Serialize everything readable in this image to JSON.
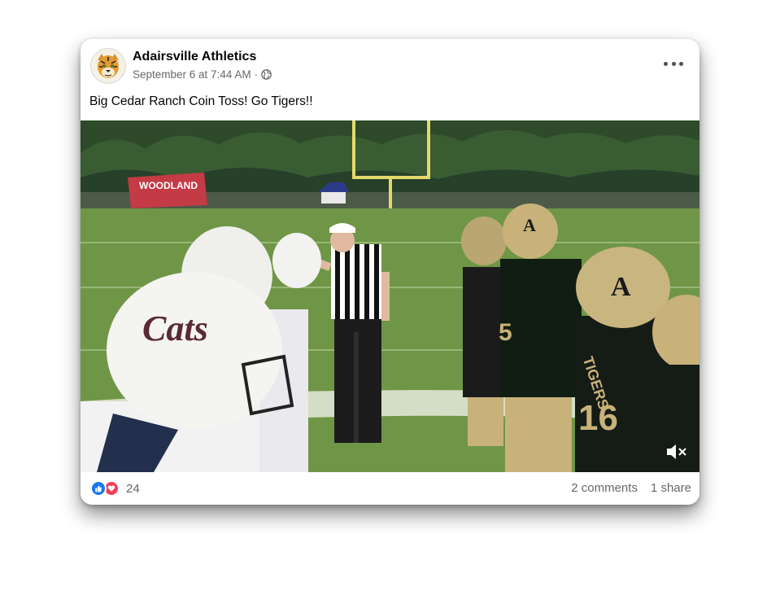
{
  "post": {
    "page_name": "Adairsville Athletics",
    "timestamp": "September 6 at 7:44 AM",
    "separator": "·",
    "privacy_icon": "globe-icon",
    "more_icon": "more-options-icon",
    "caption": "Big Cedar Ranch Coin Toss! Go Tigers!!",
    "video": {
      "banner_text": "WOODLAND",
      "helmet_logo_visitors": "Cats",
      "helmet_logo_home": "A",
      "jersey_text": "TIGERS",
      "jersey_number": "16",
      "jersey_number_center": "5",
      "sound_icon": "muted-speaker-icon"
    },
    "reactions": {
      "icons": [
        "like-icon",
        "love-icon"
      ],
      "count": "24"
    },
    "comments": "2 comments",
    "shares": "1 share"
  },
  "colors": {
    "like": "#1877f2",
    "love": "#f33e58",
    "meta_text": "#65676b",
    "home_gold": "#c8b27a",
    "visitor_maroon": "#5a2a34"
  }
}
